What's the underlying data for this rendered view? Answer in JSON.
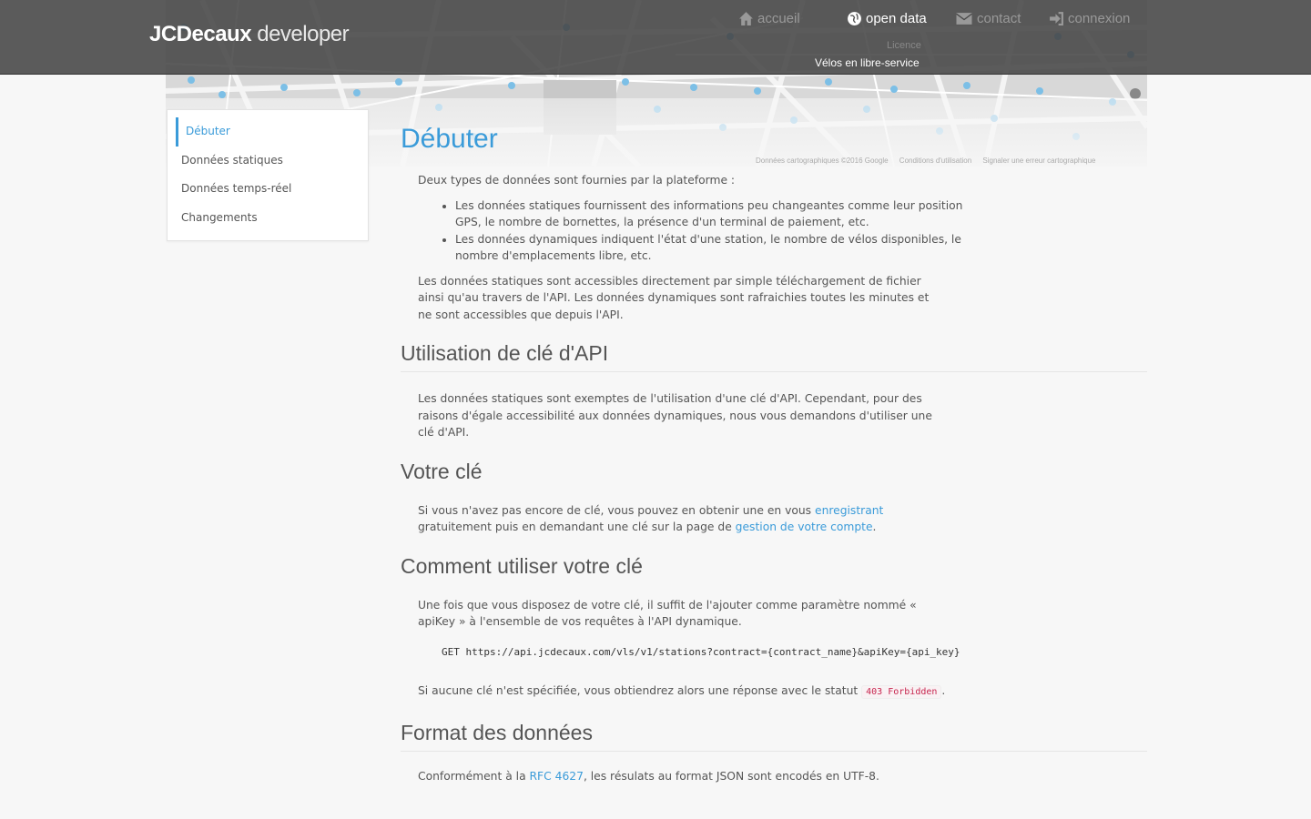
{
  "header": {
    "brand_bold": "JCDecaux",
    "brand_light": " developer",
    "nav": {
      "accueil": "accueil",
      "open_data": "open data",
      "contact": "contact",
      "connexion": "connexion"
    },
    "sub_licence": "Licence",
    "sub_velos": "Vélos en libre-service"
  },
  "map": {
    "attribution": [
      "Données cartographiques ©2016 Google",
      "Conditions d'utilisation",
      "Signaler une erreur cartographique"
    ]
  },
  "sidebar": {
    "items": [
      {
        "label": "Débuter",
        "active": true
      },
      {
        "label": "Données statiques"
      },
      {
        "label": "Données temps-réel"
      },
      {
        "label": "Changements"
      }
    ]
  },
  "content": {
    "title": "Débuter",
    "intro": "Deux types de données sont fournies par la plateforme :",
    "bullets": [
      "Les données statiques fournissent des informations peu changeantes comme leur position GPS, le nombre de bornettes, la présence d'un terminal de paiement, etc.",
      "Les données dynamiques indiquent l'état d'une station, le nombre de vélos disponibles, le nombre d'emplacements libre, etc."
    ],
    "para2": "Les données statiques sont accessibles directement par simple téléchargement de fichier ainsi qu'au travers de l'API. Les données dynamiques sont rafraichies toutes les minutes et ne sont accessibles que depuis l'API.",
    "h_api": "Utilisation de clé d'API",
    "p_api": "Les données statiques sont exemptes de l'utilisation d'une clé d'API. Cependant, pour des raisons d'égale accessibilité aux données dynamiques, nous vous demandons d'utiliser une clé d'API.",
    "h_votre": "Votre clé",
    "p_votre_a": "Si vous n'avez pas encore de clé, vous pouvez en obtenir une en vous ",
    "link_enregistrant": "enregistrant",
    "p_votre_b": " gratuitement puis en demandant une clé sur la page de ",
    "link_compte": "gestion de votre compte",
    "p_votre_c": ".",
    "h_comment": "Comment utiliser votre clé",
    "p_comment": "Une fois que vous disposez de votre clé, il suffit de l'ajouter comme paramètre nommé « apiKey » à l'ensemble de vos requêtes à l'API dynamique.",
    "code_method": "GET",
    "code_url": "https://api.jcdecaux.com/vls/v1/stations?contract={contract_name}&apiKey={api_key}",
    "p_forbidden_a": "Si aucune clé n'est spécifiée, vous obtiendrez alors une réponse avec le statut ",
    "code_forbidden": "403 Forbidden",
    "p_forbidden_b": ".",
    "h_format": "Format des données",
    "p_format_a": "Conformément à la ",
    "link_rfc": "RFC 4627",
    "p_format_b": ", les résulats au format JSON sont encodés en UTF-8."
  }
}
